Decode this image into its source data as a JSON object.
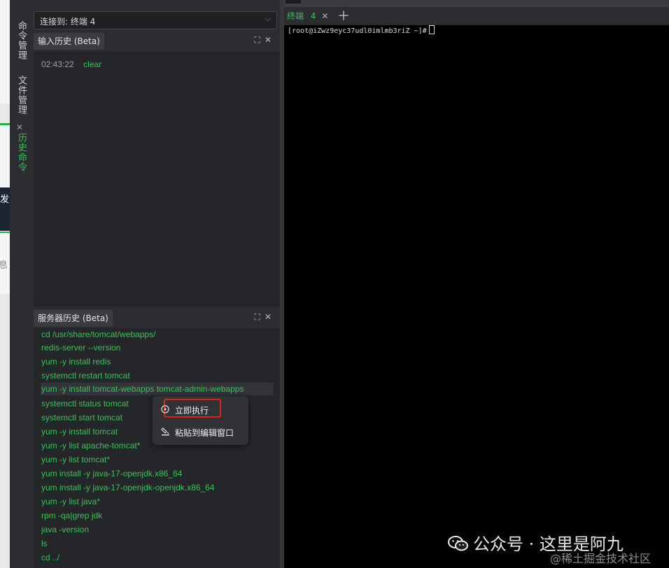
{
  "rail": {
    "tabs": [
      {
        "label": "命令管理",
        "active": false
      },
      {
        "label": "文件管理",
        "active": false
      },
      {
        "label": "历史命令",
        "active": true
      }
    ]
  },
  "left_strip": {
    "fragment_top": "发",
    "fragment_bottom": "息"
  },
  "connection": {
    "label": "连接到: 终端 4"
  },
  "input_history": {
    "title": "输入历史 (Beta)",
    "entries": [
      {
        "time": "02:43:22",
        "command": "clear"
      }
    ]
  },
  "server_history": {
    "title": "服务器历史 (Beta)",
    "commands": [
      "cd /usr/share/tomcat/webapps/",
      "redis-server --version",
      "yum -y install redis",
      "systemctl restart tomcat",
      "yum -y install tomcat-webapps tomcat-admin-webapps",
      "systemctl status tomcat",
      "systemctl start tomcat",
      "yum -y install tomcat",
      "yum -y list apache-tomcat*",
      "yum -y list tomcat*",
      "yum install -y java-17-openjdk.x86_64",
      "yum install -y java-17-openjdk-openjdk.x86_64",
      "yum -y list java*",
      "rpm -qa|grep jdk",
      "java -version",
      "ls",
      "cd ../"
    ],
    "highlighted_index": 4
  },
  "context_menu": {
    "items": [
      {
        "label": "立即执行",
        "icon": "play-circle-icon"
      },
      {
        "label": "粘贴到编辑窗口",
        "icon": "paste-icon"
      }
    ]
  },
  "terminal": {
    "tab_label": "终端",
    "tab_number": "4",
    "prompt": "[root@iZwz9eyc37udl0imlmb3riZ ~]#"
  },
  "watermark": {
    "line1": "公众号 · 这里是阿九",
    "line2": "@稀土掘金技术社区"
  },
  "colors": {
    "accent_green": "#3ec15e",
    "highlight_red": "#e0221d",
    "panel_bg": "#2b2d30",
    "terminal_bg": "#000000"
  }
}
